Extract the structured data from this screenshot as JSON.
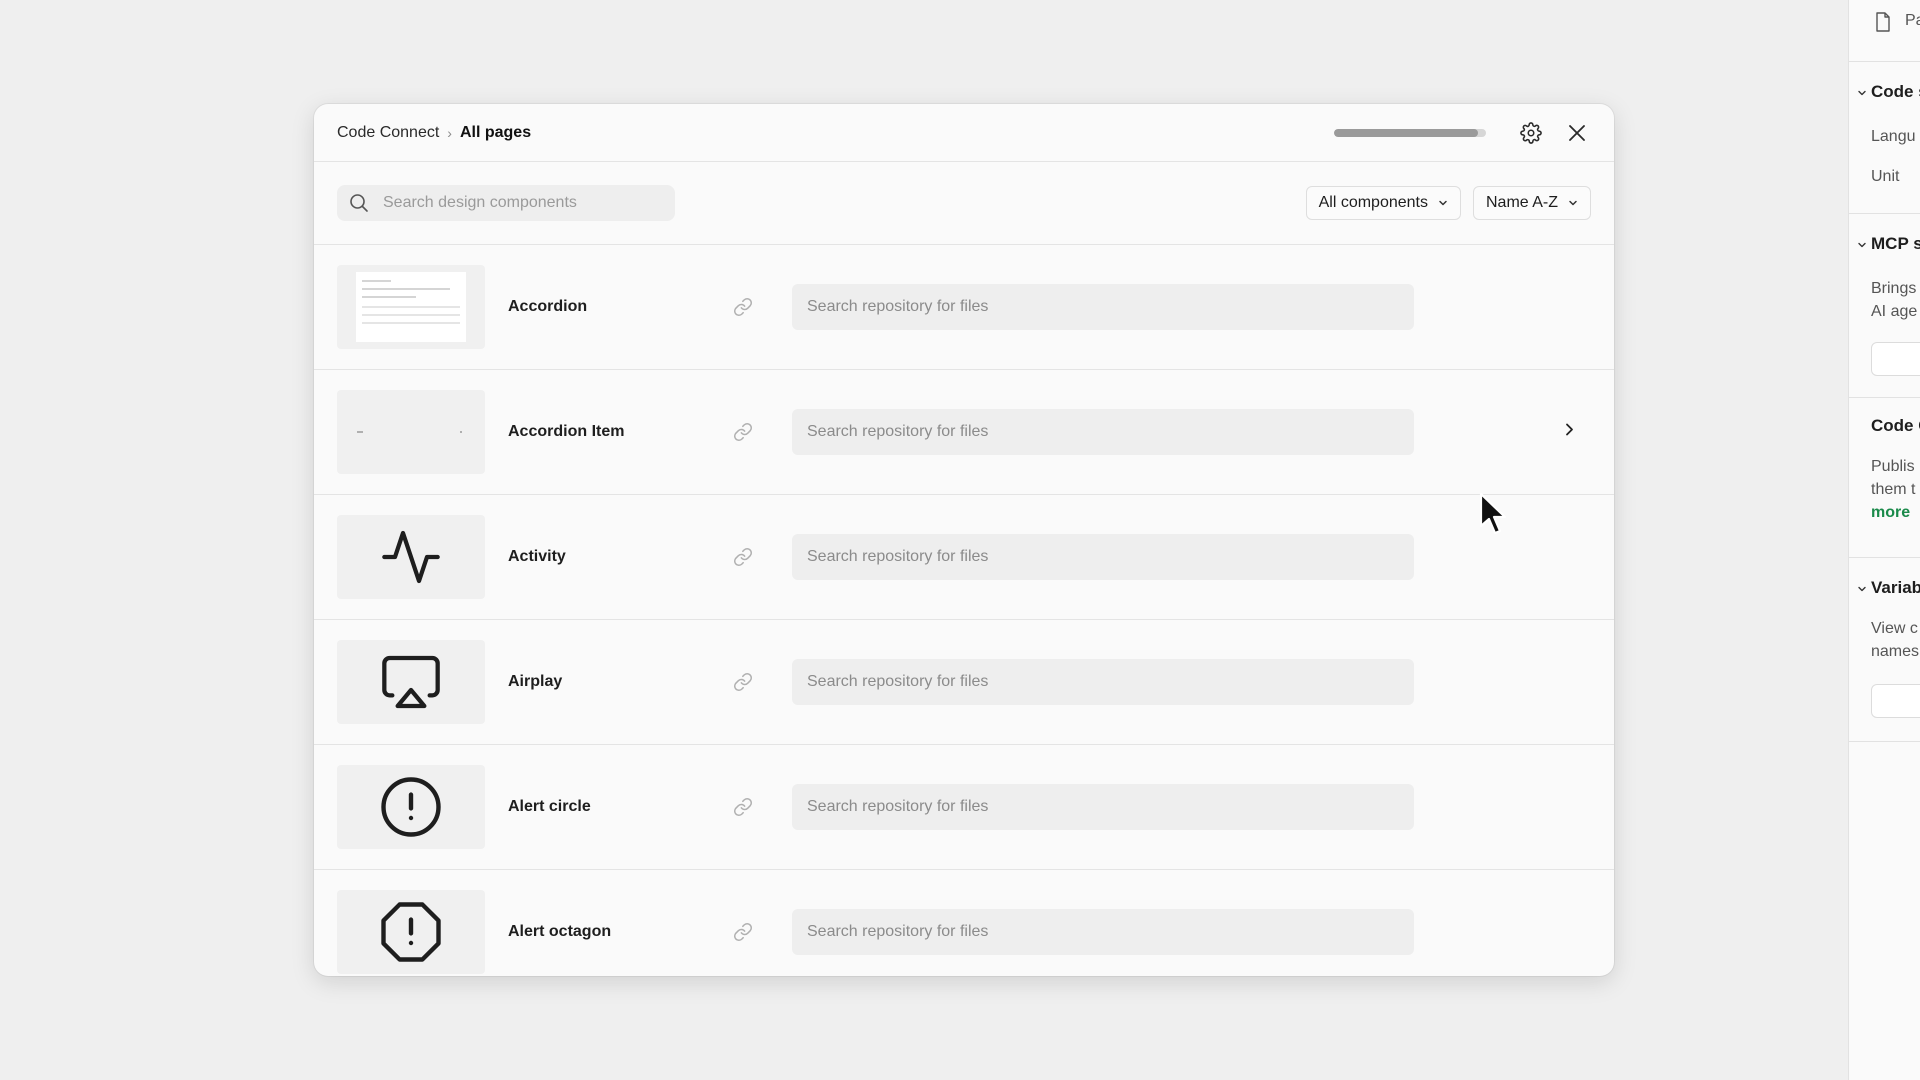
{
  "breadcrumb": {
    "parent": "Code Connect",
    "separator": "›",
    "current": "All pages"
  },
  "header": {
    "progress": 0.95,
    "icons": [
      "gear-icon",
      "close-icon"
    ]
  },
  "toolbar": {
    "search_placeholder": "Search design components",
    "filter_label": "All components",
    "sort_label": "Name A-Z"
  },
  "components": [
    {
      "name": "Accordion",
      "repo_placeholder": "Search repository for files",
      "thumb": "accordion-preview"
    },
    {
      "name": "Accordion Item",
      "repo_placeholder": "Search repository for files",
      "thumb": "accordion-item-preview",
      "hover": true
    },
    {
      "name": "Activity",
      "repo_placeholder": "Search repository for files",
      "thumb": "activity-icon"
    },
    {
      "name": "Airplay",
      "repo_placeholder": "Search repository for files",
      "thumb": "airplay-icon"
    },
    {
      "name": "Alert circle",
      "repo_placeholder": "Search repository for files",
      "thumb": "alert-circle-icon"
    },
    {
      "name": "Alert octagon",
      "repo_placeholder": "Search repository for files",
      "thumb": "alert-octagon-icon"
    }
  ],
  "side_panel": {
    "top_item": "Pa",
    "code_settings": {
      "title": "Code s",
      "language": "Langu",
      "unit": "Unit"
    },
    "mcp": {
      "title": "MCP s",
      "line1": "Brings",
      "line2": "AI age"
    },
    "code_connect": {
      "title": "Code C",
      "line1": "Publis",
      "line2": "them t",
      "link": "more"
    },
    "variables": {
      "title": "Variab",
      "line1": "View c",
      "line2": "names"
    }
  }
}
